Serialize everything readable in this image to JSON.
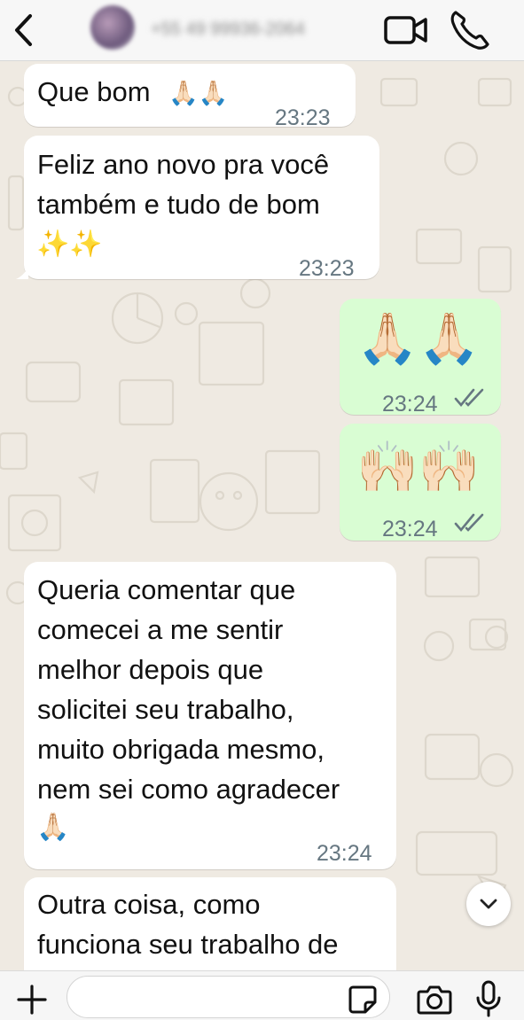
{
  "header": {
    "contact_name": "+55 49 99936-2064",
    "icons": {
      "back": "chevron-left-icon",
      "video": "video-call-icon",
      "phone": "phone-call-icon"
    }
  },
  "messages": [
    {
      "direction": "incoming",
      "text": "Que bom",
      "emoji": "🙏🏻🙏🏻",
      "time": "23:23"
    },
    {
      "direction": "incoming",
      "lines": [
        "Feliz ano novo pra você",
        "também e tudo de bom"
      ],
      "emoji": "✨✨",
      "time": "23:23"
    },
    {
      "direction": "outgoing",
      "emoji": "🙏🏻🙏🏻",
      "time": "23:24",
      "status": "read"
    },
    {
      "direction": "outgoing",
      "emoji": "🙌🏻🙌🏻",
      "time": "23:24",
      "status": "read"
    },
    {
      "direction": "incoming",
      "lines": [
        "Queria comentar que",
        "comecei a me sentir",
        "melhor depois que",
        "solicitei seu trabalho,",
        "muito obrigada mesmo,",
        "nem sei como agradecer"
      ],
      "emoji": "🙏🏻",
      "time": "23:24"
    },
    {
      "direction": "incoming",
      "lines": [
        "Outra coisa, como",
        "funciona seu trabalho de"
      ]
    }
  ],
  "footer": {
    "placeholder": "",
    "icons": {
      "attach": "plus-icon",
      "sticker": "sticker-icon",
      "camera": "camera-icon",
      "mic": "microphone-icon"
    }
  },
  "colors": {
    "incoming": "#ffffff",
    "outgoing": "#d9fdd3",
    "wallpaper": "#efeae2",
    "tick": "#667781"
  }
}
